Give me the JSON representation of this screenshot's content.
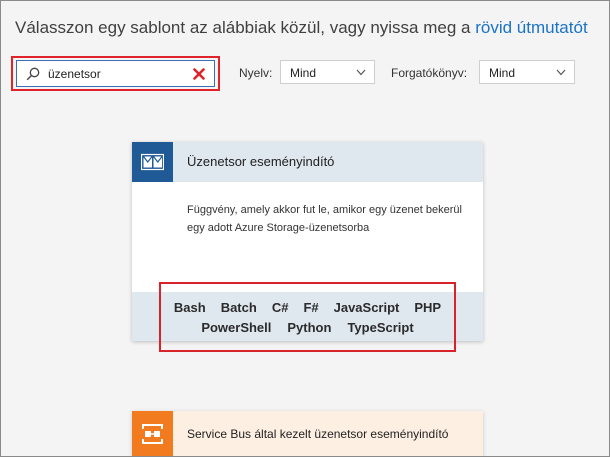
{
  "header": {
    "prompt": "Válasszon egy sablont az alábbiak közül, vagy nyissa meg a",
    "link_label": "rövid útmutatót"
  },
  "search": {
    "value": "üzenetsor",
    "icon": "search-icon",
    "clear_icon": "close-icon"
  },
  "filters": {
    "language": {
      "label": "Nyelv:",
      "value": "Mind"
    },
    "scenario": {
      "label": "Forgatókönyv:",
      "value": "Mind"
    }
  },
  "templates": [
    {
      "title": "Üzenetsor eseményindító",
      "description": "Függvény, amely akkor fut le, amikor egy üzenet bekerül egy adott Azure Storage-üzenetsorba",
      "icon": "queue-envelope-icon",
      "languages_row1": [
        "Bash",
        "Batch",
        "C#",
        "F#",
        "JavaScript",
        "PHP"
      ],
      "languages_row2": [
        "PowerShell",
        "Python",
        "TypeScript"
      ]
    },
    {
      "title": "Service Bus által kezelt üzenetsor eseményindító",
      "icon": "service-bus-icon"
    }
  ],
  "colors": {
    "highlight": "#e0222a",
    "link": "#1a73c7",
    "queue_icon_bg": "#1f5a96",
    "service_bus_icon_bg": "#f27b1f",
    "card_header_bg": "#dfe7ef"
  }
}
